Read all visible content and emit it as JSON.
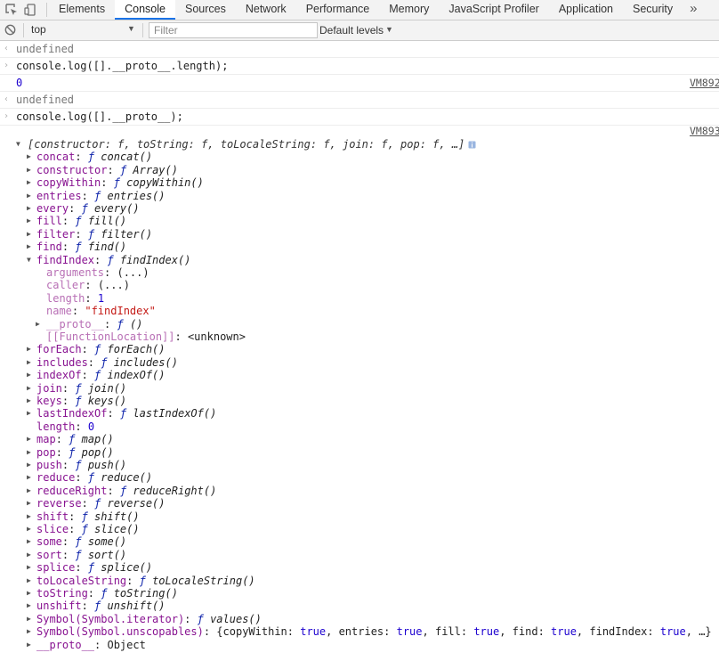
{
  "tabs": [
    "Elements",
    "Console",
    "Sources",
    "Network",
    "Performance",
    "Memory",
    "JavaScript Profiler",
    "Application",
    "Security"
  ],
  "active_tab": "Console",
  "more_tabs": "»",
  "toolbar": {
    "context": "top",
    "filter_placeholder": "Filter",
    "levels": "Default levels"
  },
  "console": {
    "r1_text": "undefined",
    "r2_cmd": "console.log([].__proto__.length);",
    "r3_value": "0",
    "r3_src": "VM892",
    "r4_text": "undefined",
    "r5_cmd": "console.log([].__proto__);",
    "r6_src": "VM893",
    "summary": "[constructor: f, toString: f, toLocaleString: f, join: f, pop: f, …]"
  },
  "tree": {
    "items": [
      {
        "k": "concat",
        "v": "concat()"
      },
      {
        "k": "constructor",
        "v": "Array()"
      },
      {
        "k": "copyWithin",
        "v": "copyWithin()"
      },
      {
        "k": "entries",
        "v": "entries()"
      },
      {
        "k": "every",
        "v": "every()"
      },
      {
        "k": "fill",
        "v": "fill()"
      },
      {
        "k": "filter",
        "v": "filter()"
      },
      {
        "k": "find",
        "v": "find()"
      },
      {
        "k": "findIndex",
        "v": "findIndex()"
      }
    ],
    "findIndex_children": {
      "arguments": "(...)",
      "caller": "(...)",
      "length": "1",
      "name": "\"findIndex\"",
      "proto_key": "__proto__",
      "proto_val": "()",
      "fl_key": "[[FunctionLocation]]",
      "fl_val": "<unknown>"
    },
    "items2": [
      {
        "k": "forEach",
        "v": "forEach()"
      },
      {
        "k": "includes",
        "v": "includes()"
      },
      {
        "k": "indexOf",
        "v": "indexOf()"
      },
      {
        "k": "join",
        "v": "join()"
      },
      {
        "k": "keys",
        "v": "keys()"
      },
      {
        "k": "lastIndexOf",
        "v": "lastIndexOf()"
      }
    ],
    "length_key": "length",
    "length_val": "0",
    "items3": [
      {
        "k": "map",
        "v": "map()"
      },
      {
        "k": "pop",
        "v": "pop()"
      },
      {
        "k": "push",
        "v": "push()"
      },
      {
        "k": "reduce",
        "v": "reduce()"
      },
      {
        "k": "reduceRight",
        "v": "reduceRight()"
      },
      {
        "k": "reverse",
        "v": "reverse()"
      },
      {
        "k": "shift",
        "v": "shift()"
      },
      {
        "k": "slice",
        "v": "slice()"
      },
      {
        "k": "some",
        "v": "some()"
      },
      {
        "k": "sort",
        "v": "sort()"
      },
      {
        "k": "splice",
        "v": "splice()"
      },
      {
        "k": "toLocaleString",
        "v": "toLocaleString()"
      },
      {
        "k": "toString",
        "v": "toString()"
      },
      {
        "k": "unshift",
        "v": "unshift()"
      },
      {
        "k": "Symbol(Symbol.iterator)",
        "v": "values()"
      }
    ],
    "unscopables_key": "Symbol(Symbol.unscopables)",
    "unscopables_val": "{copyWithin: true, entries: true, fill: true, find: true, findIndex: true, …}",
    "proto_key": "__proto__",
    "proto_val": "Object"
  },
  "colors": {
    "accent": "#1a73e8",
    "prop_key": "#881391",
    "number": "#1c00cf",
    "string": "#c41a16"
  },
  "icons": [
    "inspect-icon",
    "device-toolbar-icon",
    "clear-console-icon",
    "info-icon"
  ]
}
